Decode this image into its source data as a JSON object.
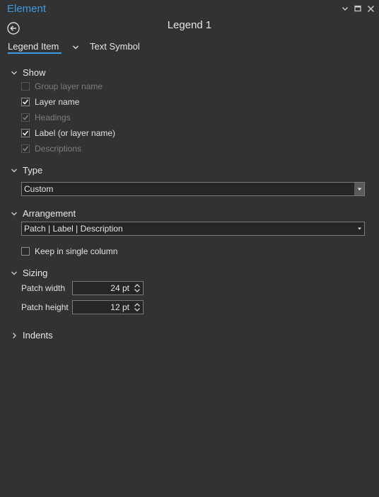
{
  "pane": {
    "title": "Element"
  },
  "header": {
    "title": "Legend 1"
  },
  "tabs": [
    {
      "label": "Legend Item",
      "active": true
    },
    {
      "label": "Text Symbol",
      "active": false
    }
  ],
  "show": {
    "title": "Show",
    "items": [
      {
        "label": "Group layer name",
        "checked": false,
        "enabled": false
      },
      {
        "label": "Layer name",
        "checked": true,
        "enabled": true
      },
      {
        "label": "Headings",
        "checked": true,
        "enabled": false
      },
      {
        "label": "Label (or layer name)",
        "checked": true,
        "enabled": true
      },
      {
        "label": "Descriptions",
        "checked": true,
        "enabled": false
      }
    ]
  },
  "type": {
    "title": "Type",
    "value": "Custom"
  },
  "arrangement": {
    "title": "Arrangement",
    "value": "Patch | Label | Description",
    "single_column_label": "Keep in single column",
    "single_column_checked": false
  },
  "sizing": {
    "title": "Sizing",
    "patch_width_label": "Patch width",
    "patch_width_value": "24 pt",
    "patch_height_label": "Patch height",
    "patch_height_value": "12 pt"
  },
  "indents": {
    "title": "Indents"
  },
  "colors": {
    "accent": "#3e9be0",
    "background": "#323232"
  }
}
